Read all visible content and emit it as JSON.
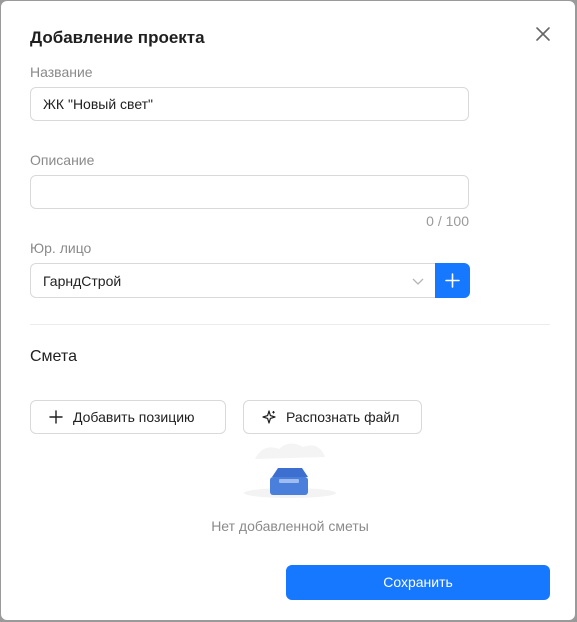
{
  "dialog": {
    "title": "Добавление проекта",
    "close_icon": "close-icon"
  },
  "form": {
    "name": {
      "label": "Название",
      "value": "ЖК \"Новый свет\""
    },
    "description": {
      "label": "Описание",
      "value": "",
      "counter": "0 / 100"
    },
    "legal_entity": {
      "label": "Юр. лицо",
      "selected": "ГарндСтрой",
      "dropdown_icon": "chevron-down-icon",
      "add_icon": "plus-icon"
    }
  },
  "estimate": {
    "section_title": "Смета",
    "add_position_label": "Добавить позицию",
    "recognize_file_label": "Распознать файл",
    "empty_text": "Нет добавленной сметы"
  },
  "footer": {
    "save_label": "Сохранить"
  },
  "colors": {
    "accent": "#1677ff",
    "border": "#d9d9d9",
    "muted": "#8a8a8a"
  }
}
